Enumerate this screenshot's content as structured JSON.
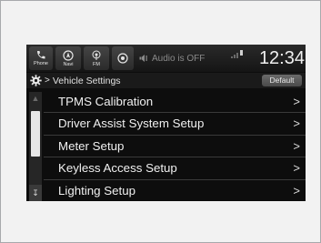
{
  "statusbar": {
    "buttons": [
      {
        "label": "Phone",
        "icon": "phone-icon"
      },
      {
        "label": "Navi",
        "icon": "navi-icon"
      },
      {
        "label": "FM",
        "icon": "fm-radio-icon"
      },
      {
        "label": "",
        "icon": "sirius-icon"
      }
    ],
    "audio_text": "Audio is OFF",
    "audio_icon": "speaker-icon",
    "clock": "12:34"
  },
  "header": {
    "settings_icon": "gear-icon",
    "separator": ">",
    "title": "Vehicle Settings",
    "default_label": "Default"
  },
  "menu": {
    "items": [
      {
        "label": "TPMS Calibration"
      },
      {
        "label": "Driver Assist System Setup"
      },
      {
        "label": "Meter Setup"
      },
      {
        "label": "Keyless Access Setup"
      },
      {
        "label": "Lighting Setup"
      }
    ],
    "chevron": ">"
  },
  "colors": {
    "screen_bg": "#0d0d0d",
    "text": "#f0f0f0",
    "default_button": "#5a5a5a"
  }
}
